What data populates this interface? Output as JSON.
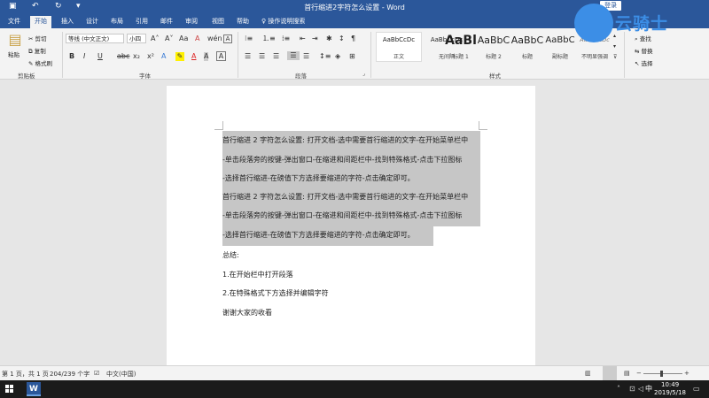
{
  "titlebar": {
    "title": "首行缩进2字符怎么设置 - Word",
    "login": "登录",
    "color": "#2b579a"
  },
  "tabs": [
    "文件",
    "开始",
    "插入",
    "设计",
    "布局",
    "引用",
    "邮件",
    "审阅",
    "视图",
    "帮助"
  ],
  "tell_me": "操作说明搜索",
  "ribbon": {
    "clipboard": {
      "paste": "粘贴",
      "cut": "剪切",
      "copy": "复制",
      "format_painter": "格式刷",
      "label": "剪贴板"
    },
    "font": {
      "font_name": "等线 (中文正文)",
      "font_size": "小四",
      "label": "字体"
    },
    "paragraph": {
      "label": "段落"
    },
    "styles": {
      "items": [
        {
          "sample": "AaBbCcDc",
          "name": "正文"
        },
        {
          "sample": "AaBbCcDc",
          "name": "无间隔"
        },
        {
          "sample": "AaBl",
          "name": "标题 1"
        },
        {
          "sample": "AaBbC",
          "name": "标题 2"
        },
        {
          "sample": "AaBbC",
          "name": "标题"
        },
        {
          "sample": "AaBbC",
          "name": "副标题"
        },
        {
          "sample": "AaBbCcDc",
          "name": "不明显强调"
        }
      ],
      "label": "样式"
    },
    "editing": {
      "find": "查找",
      "replace": "替换",
      "select": "选择"
    }
  },
  "document": {
    "lines": [
      "首行缩进 2 字符怎么设置: 打开文档-选中需要首行缩进的文字-在开始菜单栏中",
      "-单击段落旁的按键-弹出窗口-在缩进和间距栏中-找到特殊格式-点击下拉图标",
      "-选择首行缩进-在磅值下方选择要缩进的字符-点击确定即可。",
      "首行缩进 2 字符怎么设置: 打开文档-选中需要首行缩进的文字-在开始菜单栏中",
      "-单击段落旁的按键-弹出窗口-在缩进和间距栏中-找到特殊格式-点击下拉图标",
      "-选择首行缩进-在磅值下方选择要缩进的字符-点击确定即可。",
      "总结:",
      "1.在开始栏中打开段落",
      "2.在特殊格式下方选择并编辑字符",
      "谢谢大家的收看"
    ]
  },
  "statusbar": {
    "page": "第 1 页，共 1 页",
    "words": "204/239 个字",
    "language": "中文(中国)"
  },
  "taskbar": {
    "ime": "中",
    "time": "10:49",
    "date": "2019/5/18"
  },
  "watermark": {
    "text": "云骑士"
  }
}
